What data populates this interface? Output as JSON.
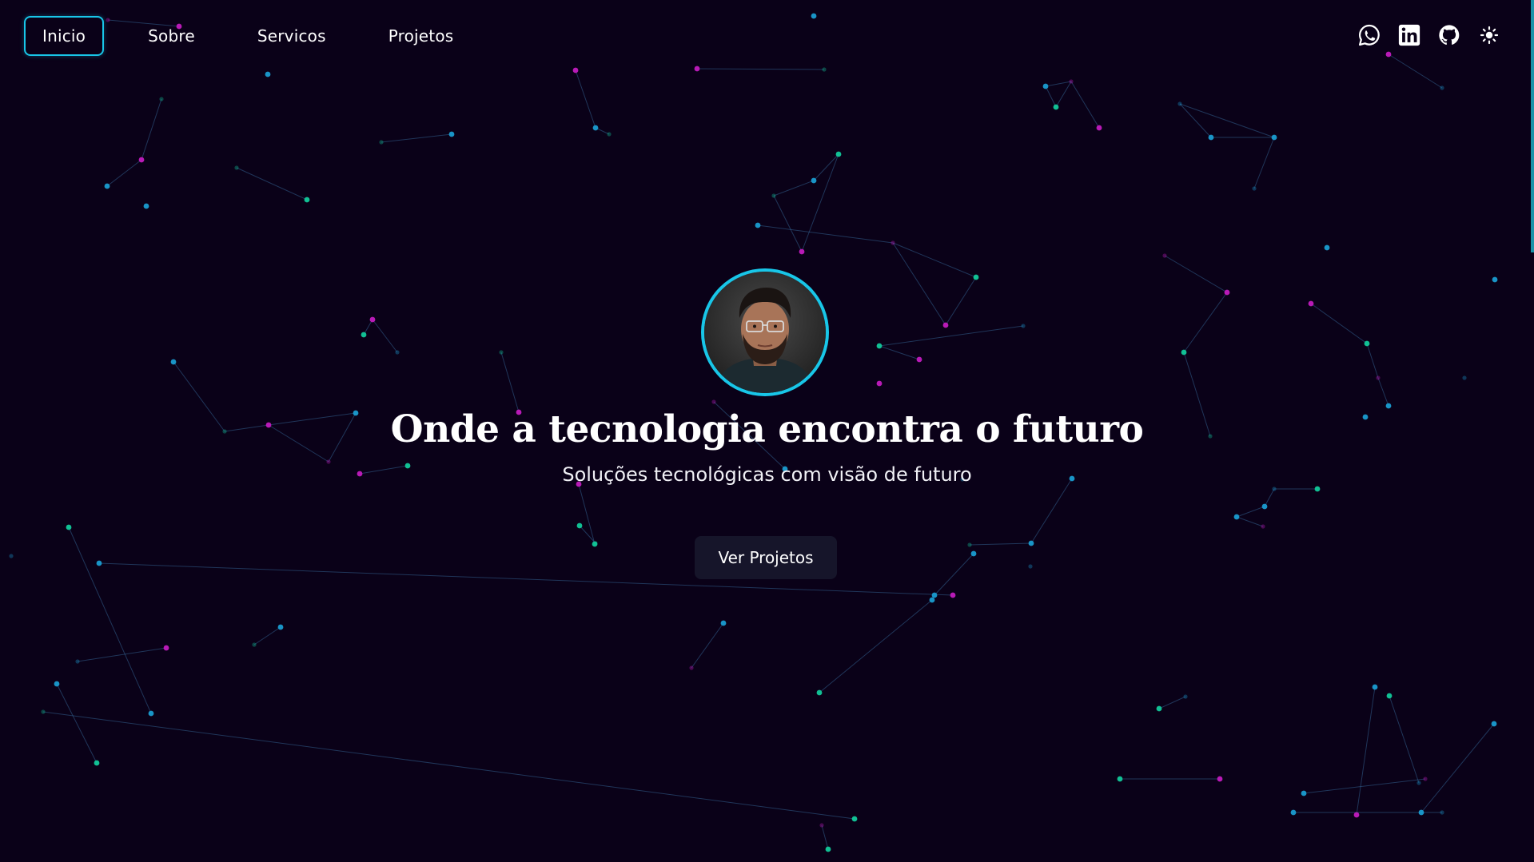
{
  "nav": {
    "links": [
      {
        "label": "Inicio",
        "active": true
      },
      {
        "label": "Sobre",
        "active": false
      },
      {
        "label": "Servicos",
        "active": false
      },
      {
        "label": "Projetos",
        "active": false
      }
    ],
    "icons": [
      "whatsapp-icon",
      "linkedin-icon",
      "github-icon",
      "sun-icon"
    ]
  },
  "hero": {
    "title": "Onde a tecnologia encontra o futuro",
    "subtitle": "Soluções tecnológicas com visão de futuro",
    "cta_label": "Ver Projetos"
  },
  "colors": {
    "background": "#0a0118",
    "accent_cyan": "#18c6e8",
    "node_magenta": "#c21bbf",
    "node_green": "#12c99a",
    "node_blue": "#1a9cd0",
    "button_bg": "#16152a"
  }
}
